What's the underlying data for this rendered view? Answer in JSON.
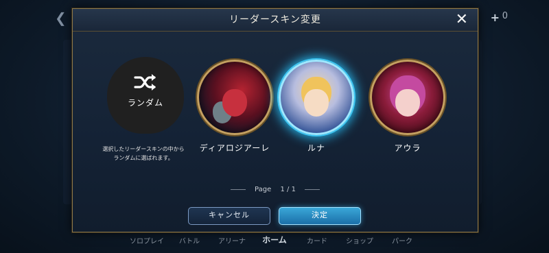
{
  "background": {
    "top_right_value": "0",
    "nav_items": [
      {
        "label": "ソロプレイ"
      },
      {
        "label": "バトル"
      },
      {
        "label": "アリーナ"
      },
      {
        "label": "ホーム"
      },
      {
        "label": "カード"
      },
      {
        "label": "ショップ"
      },
      {
        "label": "パーク"
      }
    ]
  },
  "modal": {
    "title": "リーダースキン変更",
    "random": {
      "label": "ランダム",
      "description": "選択したリーダースキンの中から\nランダムに選ばれます。"
    },
    "skins": [
      {
        "name": "ディアロジアーレ",
        "selected": false
      },
      {
        "name": "ルナ",
        "selected": true
      },
      {
        "name": "アウラ",
        "selected": false
      }
    ],
    "pagination": {
      "label": "Page",
      "current": "1",
      "separator": "/",
      "total": "1"
    },
    "buttons": {
      "cancel": "キャンセル",
      "confirm": "決定"
    }
  },
  "colors": {
    "frame_gold": "#c4a060",
    "selected_glow": "#3fc7f2",
    "confirm_button": "#2a8cc4"
  }
}
